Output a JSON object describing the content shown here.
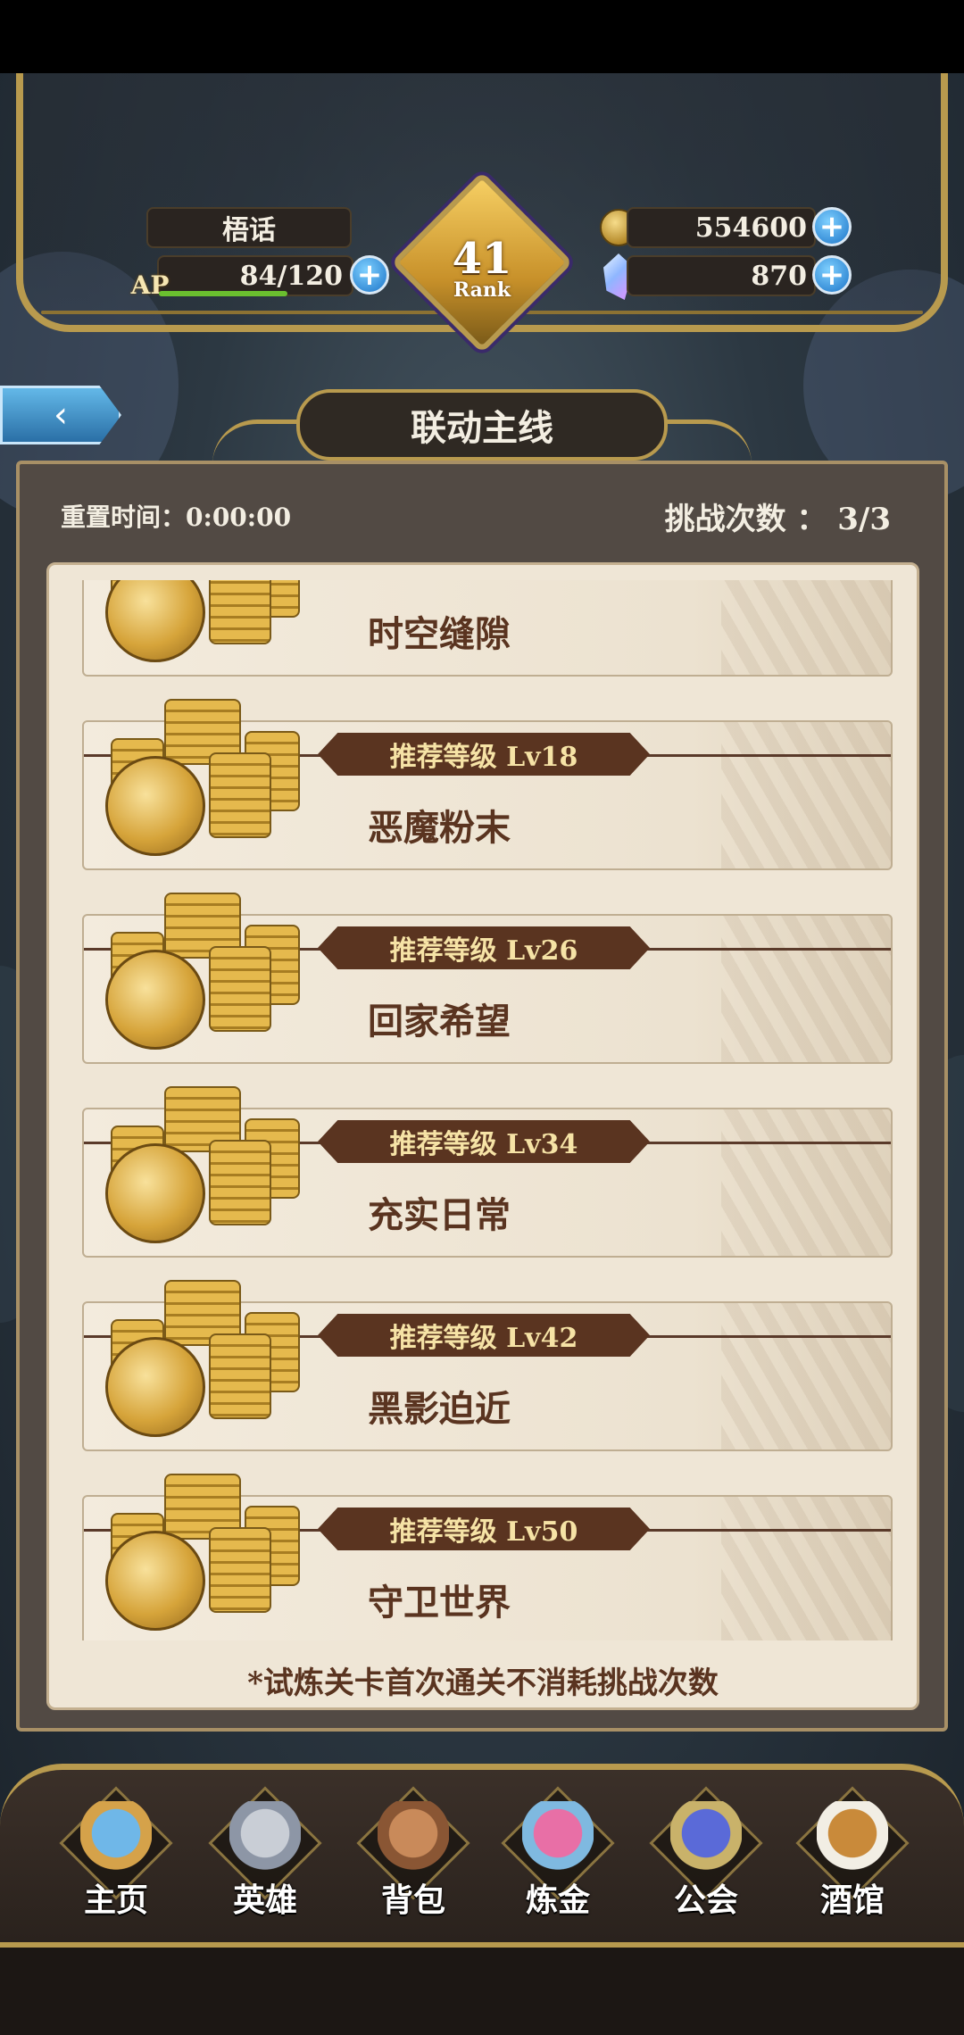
{
  "player": {
    "name": "梧话",
    "ap_label": "AP",
    "ap_value": "84/120",
    "ap_fraction": 0.7,
    "rank_number": "41",
    "rank_label": "Rank",
    "gold": "554600",
    "crystals": "870"
  },
  "plus_symbol": "+",
  "back_arrow": "‹",
  "page_title": "联动主线",
  "reset_time": "重置时间：0:00:00",
  "challenge_count": "挑战次数 ： 3/3",
  "stages": [
    {
      "name": "时空缝隙",
      "level": "",
      "partial": true
    },
    {
      "name": "恶魔粉末",
      "level": "推荐等级  Lv18"
    },
    {
      "name": "回家希望",
      "level": "推荐等级  Lv26"
    },
    {
      "name": "充实日常",
      "level": "推荐等级  Lv34"
    },
    {
      "name": "黑影迫近",
      "level": "推荐等级  Lv42"
    },
    {
      "name": "守卫世界",
      "level": "推荐等级  Lv50"
    }
  ],
  "footnote": "*试炼关卡首次通关不消耗挑战次数",
  "nav": [
    {
      "label": "主页",
      "icon": "castle-icon"
    },
    {
      "label": "英雄",
      "icon": "hero-helmet-icon"
    },
    {
      "label": "背包",
      "icon": "backpack-icon"
    },
    {
      "label": "炼金",
      "icon": "alchemy-flask-icon"
    },
    {
      "label": "公会",
      "icon": "guild-shield-icon"
    },
    {
      "label": "酒馆",
      "icon": "tavern-mug-icon"
    }
  ],
  "colors": {
    "gold_trim": "#b89a4e",
    "card_bg": "#efe6d6",
    "level_tag": "#5a3420",
    "plus_blue": "#1b74c8",
    "ap_green": "#6abf2f"
  }
}
